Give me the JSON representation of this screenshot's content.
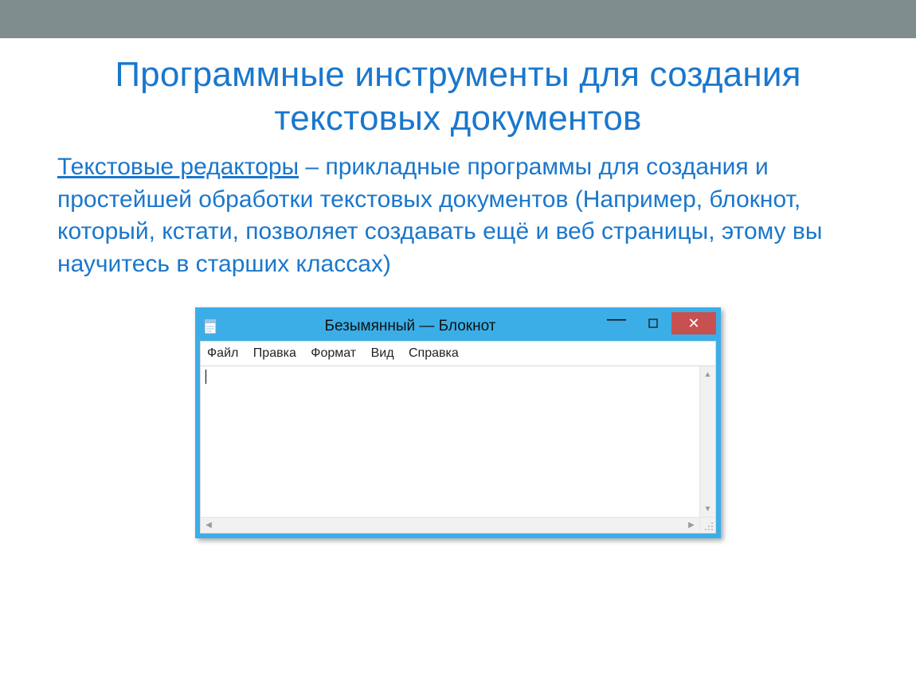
{
  "slide": {
    "title": "Программные инструменты для создания текстовых документов",
    "paragraph_lead": "Текстовые редакторы",
    "paragraph_rest": " – прикладные программы для создания и простейшей обработки текстовых документов (Например, блокнот, который, кстати, позволяет создавать ещё и веб страницы, этому вы научитесь в старших классах)"
  },
  "notepad": {
    "window_title": "Безымянный — Блокнот",
    "menus": [
      "Файл",
      "Правка",
      "Формат",
      "Вид",
      "Справка"
    ]
  },
  "colors": {
    "accent": "#1a77cc",
    "topbar": "#7f8d8c",
    "notepad_frame": "#3baee7",
    "close": "#c75050"
  }
}
